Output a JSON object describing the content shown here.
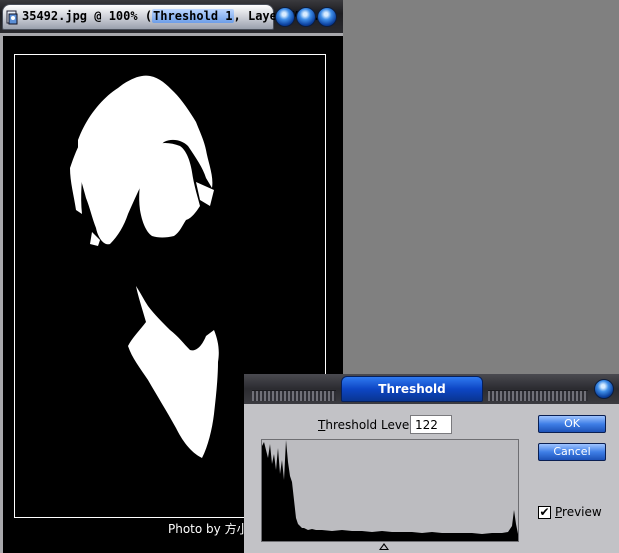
{
  "document_window": {
    "title_prefix": "35492.jpg @ 100% (",
    "title_selected": "Threshold 1",
    "title_suffix": ", Layer Ma...",
    "photo_credit": "Photo by 方小"
  },
  "threshold_dialog": {
    "title": "Threshold",
    "level_label_underlined": "T",
    "level_label_rest": "hreshold Level:",
    "level_value": "122",
    "ok_label": "OK",
    "cancel_label": "Cancel",
    "preview_checked": "✔",
    "preview_label_underlined": "P",
    "preview_label_rest": "review"
  },
  "colors": {
    "accent": "#1d52b8",
    "desktop": "#808080",
    "dialog_bg": "#c2c2c6"
  },
  "icons": [
    "document-file-icon",
    "minimize-orb-icon",
    "maximize-orb-icon",
    "close-orb-icon",
    "dialog-close-orb-icon",
    "slider-triangle-icon"
  ]
}
